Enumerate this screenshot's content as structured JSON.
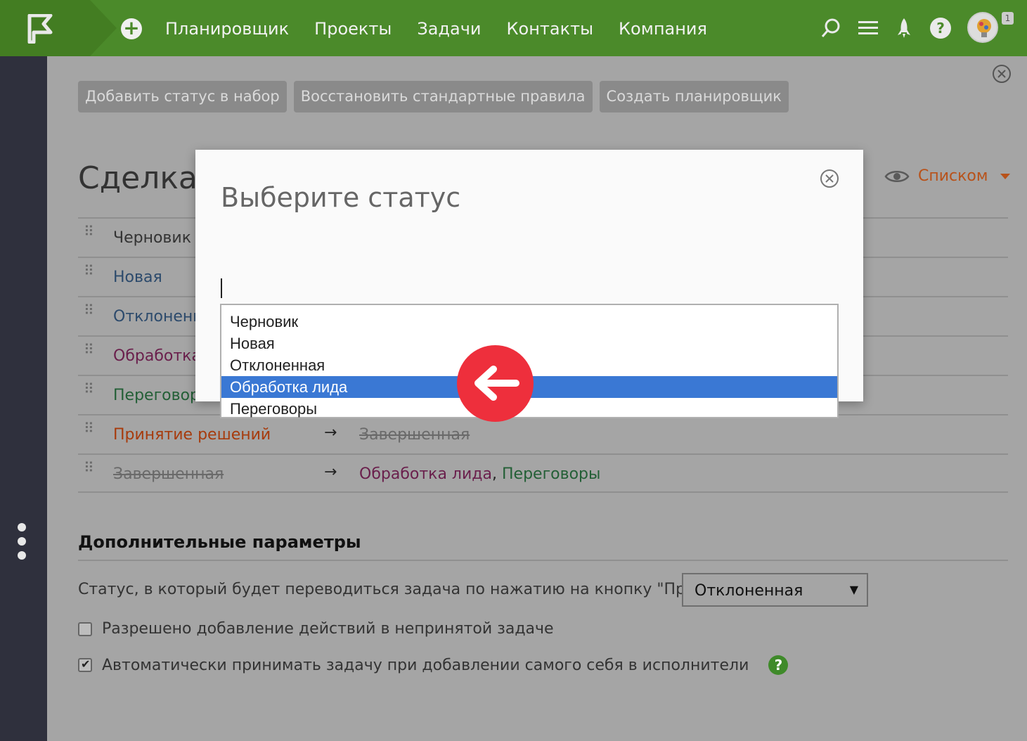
{
  "topbar": {
    "nav": [
      "Планировщик",
      "Проекты",
      "Задачи",
      "Контакты",
      "Компания"
    ],
    "avatar_badge": "1",
    "brand_color": "#4b8a2a"
  },
  "toolbar": {
    "buttons": [
      "Добавить статус в набор",
      "Восстановить стандартные правила",
      "Создать планировщик"
    ]
  },
  "page": {
    "title": "Сделка ",
    "view_label": "Списком"
  },
  "statuses": [
    {
      "name": "Черновик",
      "arrow": "",
      "targets": []
    },
    {
      "name": "Новая",
      "arrow": "",
      "targets": []
    },
    {
      "name": "Отклоненн",
      "arrow": "",
      "targets": []
    },
    {
      "name": "Обработка",
      "arrow": "",
      "targets": []
    },
    {
      "name": "Переговор",
      "arrow": "",
      "targets": []
    },
    {
      "name": "Принятие решений",
      "arrow": "→",
      "targets": [
        "Завершенная"
      ]
    },
    {
      "name": "Завершенная",
      "arrow": "→",
      "targets": [
        "Обработка лида",
        ",",
        "Переговоры"
      ]
    }
  ],
  "extra": {
    "section_title": "Дополнительные параметры",
    "accept_label": "Статус, в который будет переводиться задача по нажатию на кнопку \"Принять\":",
    "accept_value": "Отклоненная",
    "check1": "Разрешено добавление действий в непринятой задаче",
    "check2": "Автоматически принимать задачу при добавлении самого себя в исполнители"
  },
  "modal": {
    "title": "Выберите статус",
    "input_value": ""
  },
  "dropdown": {
    "options": [
      "Черновик",
      "Новая",
      "Отклоненная",
      "Обработка лида",
      "Переговоры"
    ],
    "selected": "Обработка лида",
    "selected_color": "#3a78d4"
  },
  "pointer_color": "#ee2f3c"
}
